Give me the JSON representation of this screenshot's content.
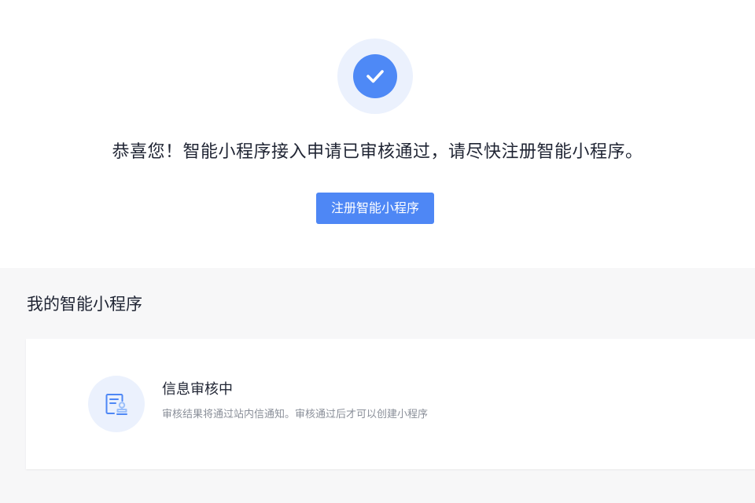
{
  "success": {
    "icon": "check-icon",
    "message": "恭喜您！智能小程序接入申请已审核通过，请尽快注册智能小程序。",
    "register_button_label": "注册智能小程序"
  },
  "my_programs": {
    "section_title": "我的智能小程序",
    "status_card": {
      "icon": "review-document-icon",
      "title": "信息审核中",
      "description": "审核结果将通过站内信通知。审核通过后才可以创建小程序"
    }
  },
  "colors": {
    "accent": "#4e87f5",
    "icon_halo": "#ebf1fd",
    "page_gray": "#f7f7f8",
    "text_primary": "#1f2433",
    "text_secondary": "#8a8f99"
  }
}
